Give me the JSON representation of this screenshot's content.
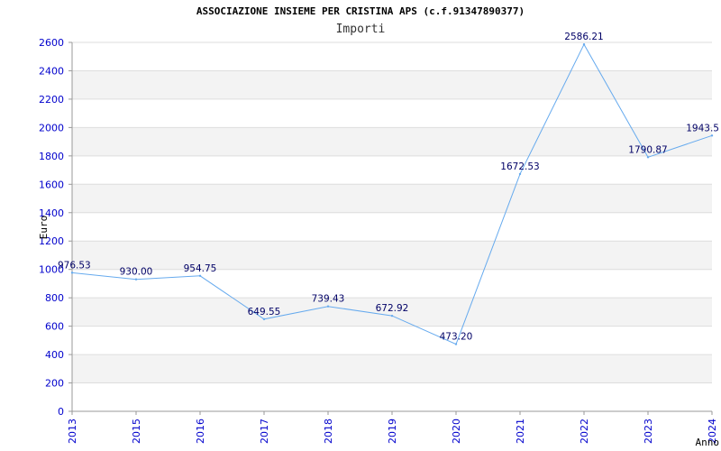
{
  "chart_data": {
    "type": "line",
    "title": "ASSOCIAZIONE INSIEME PER CRISTINA APS (c.f.91347890377)",
    "subtitle": "Importi",
    "xlabel": "Anno",
    "ylabel": "Euro",
    "categories": [
      "2013",
      "2015",
      "2016",
      "2017",
      "2018",
      "2019",
      "2020",
      "2021",
      "2022",
      "2023",
      "2024"
    ],
    "series": [
      {
        "values": [
          976.53,
          930.0,
          954.75,
          649.55,
          739.43,
          672.92,
          473.2,
          1672.53,
          2586.21,
          1790.87,
          1943.5
        ],
        "labels": [
          "976.53",
          "930.00",
          "954.75",
          "649.55",
          "739.43",
          "672.92",
          "473.20",
          "1672.53",
          "2586.21",
          "1790.87",
          "1943.5"
        ]
      }
    ],
    "ylim": [
      0,
      2600
    ],
    "yticks": [
      0,
      200,
      400,
      600,
      800,
      1000,
      1200,
      1400,
      1600,
      1800,
      2000,
      2200,
      2400,
      2600
    ],
    "grid": true,
    "colors": {
      "line": "#66aaee",
      "band": "#f3f3f3",
      "grid": "#dddddd",
      "tick": "#0000cc"
    }
  }
}
